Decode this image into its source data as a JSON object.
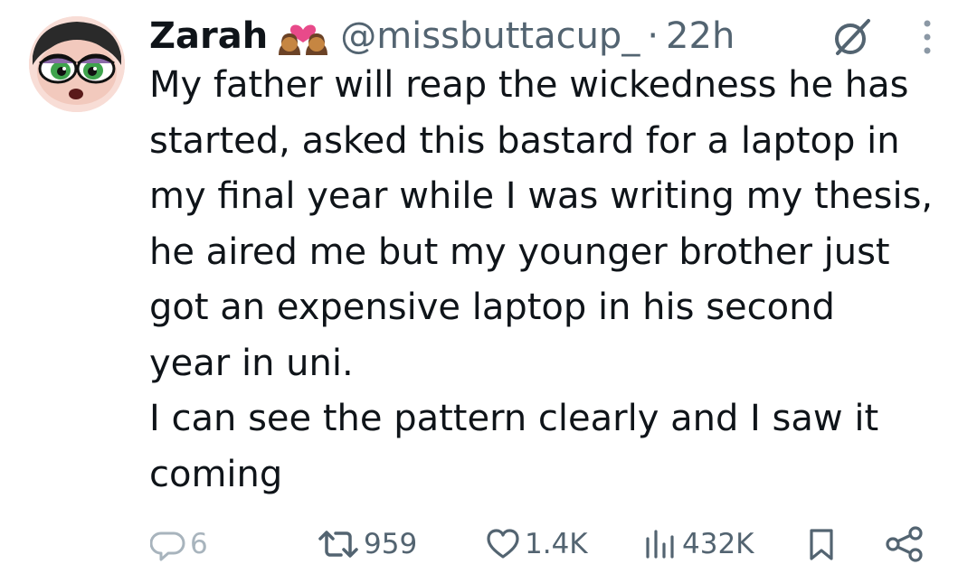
{
  "tweet": {
    "display_name": "Zarah",
    "handle": "@missbuttacup_",
    "separator": "·",
    "time": "22h",
    "text_lines": [
      "My father will reap the wickedness he has",
      "started, asked this bastard for a laptop in",
      "my final year while I was writing my thesis,",
      "he aired me but my younger brother just",
      "got an expensive laptop in his second",
      "year in uni.",
      "I can see the pattern clearly and I saw it",
      "coming"
    ]
  },
  "actions": {
    "replies": "6",
    "reposts": "959",
    "likes": "1.4K",
    "views": "432K"
  },
  "icons": {
    "avatar": "avatar-cartoon-girl",
    "badge": "two-women-heart-emoji",
    "grok": "grok-icon",
    "more": "more-vertical-icon",
    "reply": "reply-icon",
    "retweet": "retweet-icon",
    "like": "heart-icon",
    "views": "views-bar-icon",
    "bookmark": "bookmark-icon",
    "share": "share-icon"
  },
  "colors": {
    "text": "#0f1419",
    "secondary": "#536471",
    "muted": "#a8b4bd"
  }
}
